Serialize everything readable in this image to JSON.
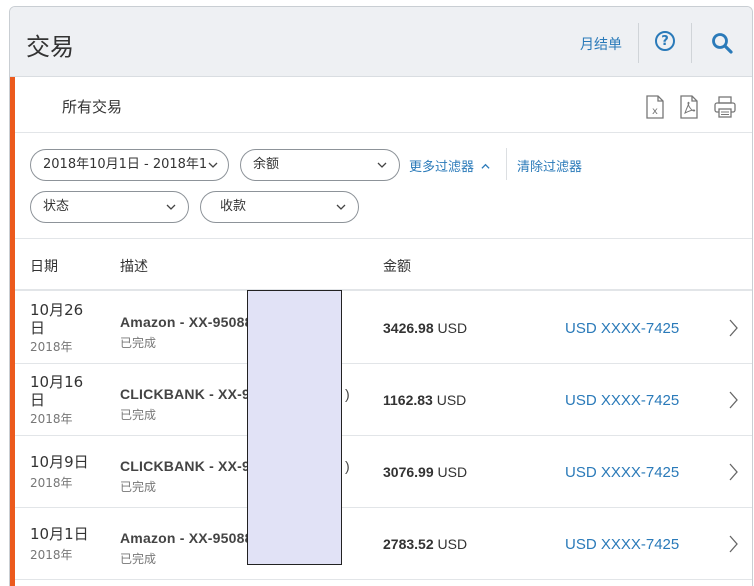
{
  "header": {
    "title": "交易",
    "statement_link": "月结单",
    "help_icon": "question-circle-icon",
    "search_icon": "search-icon"
  },
  "subheader": {
    "title": "所有交易",
    "export_icons": [
      "excel-export-icon",
      "pdf-export-icon",
      "print-icon"
    ]
  },
  "filters": {
    "date_range": "2018年10月1日 - 2018年1",
    "balance": "余额",
    "status": "状态",
    "type": "收款",
    "more_filters": "更多过滤器",
    "clear_filters": "清除过滤器"
  },
  "table": {
    "columns": {
      "date": "日期",
      "description": "描述",
      "amount": "金额"
    },
    "rows": [
      {
        "date": "10月26日",
        "year": "2018年",
        "description": "Amazon - XX-95088",
        "status": "已完成",
        "amount": "3426.98",
        "currency": "USD",
        "account": "USD XXXX-7425"
      },
      {
        "date": "10月16日",
        "year": "2018年",
        "description": "CLICKBANK - XX-95",
        "desc_suffix": ")",
        "status": "已完成",
        "amount": "1162.83",
        "currency": "USD",
        "account": "USD XXXX-7425"
      },
      {
        "date": "10月9日",
        "year": "2018年",
        "description": "CLICKBANK - XX-95",
        "desc_suffix": ")",
        "status": "已完成",
        "amount": "3076.99",
        "currency": "USD",
        "account": "USD XXXX-7425"
      },
      {
        "date": "10月1日",
        "year": "2018年",
        "description": "Amazon - XX-95088",
        "status": "已完成",
        "amount": "2783.52",
        "currency": "USD",
        "account": "USD XXXX-7425"
      }
    ]
  },
  "colors": {
    "accent": "#ec5a1d",
    "link": "#2a7ab9",
    "header_bg": "#eef0f3",
    "redaction": "#e1e2f6"
  }
}
